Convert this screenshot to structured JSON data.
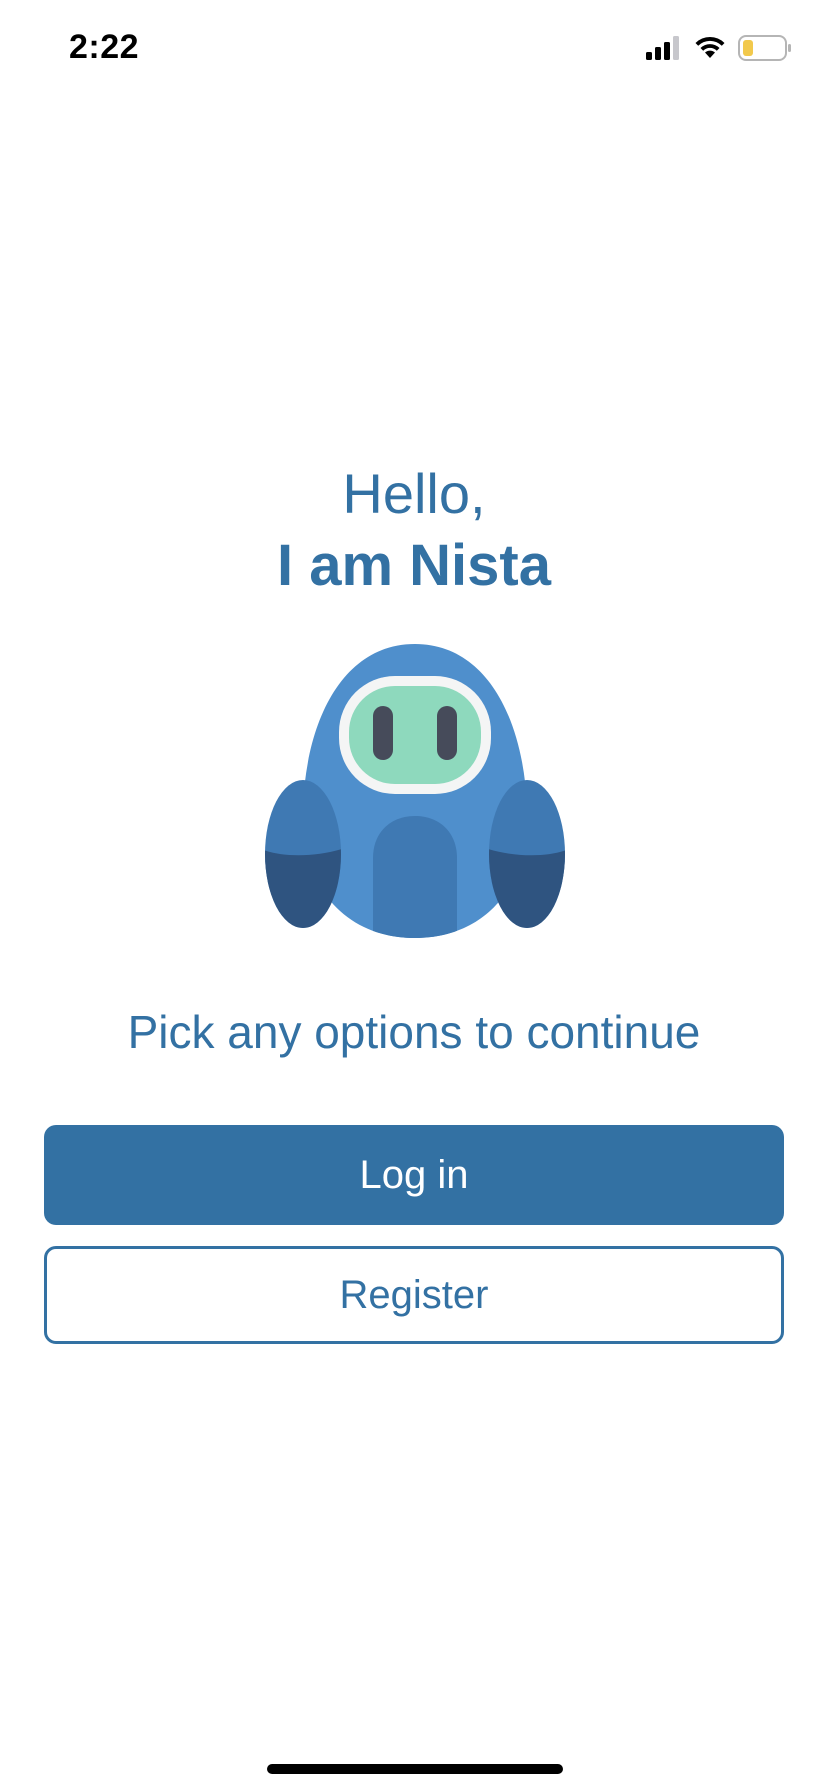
{
  "status_bar": {
    "time": "2:22",
    "icons": [
      "signal-icon",
      "wifi-icon",
      "battery-icon"
    ]
  },
  "greeting": {
    "line1": "Hello,",
    "line2": "I am Nista"
  },
  "mascot": {
    "icon": "robot-mascot-icon"
  },
  "subtitle": "Pick any options to continue",
  "actions": {
    "login_label": "Log in",
    "register_label": "Register"
  },
  "colors": {
    "accent": "#3371a3",
    "mascot_body": "#4f8fcc",
    "mascot_dark": "#2f5480",
    "mascot_face": "#8ed9bd",
    "battery_level": "#f2c94c"
  }
}
